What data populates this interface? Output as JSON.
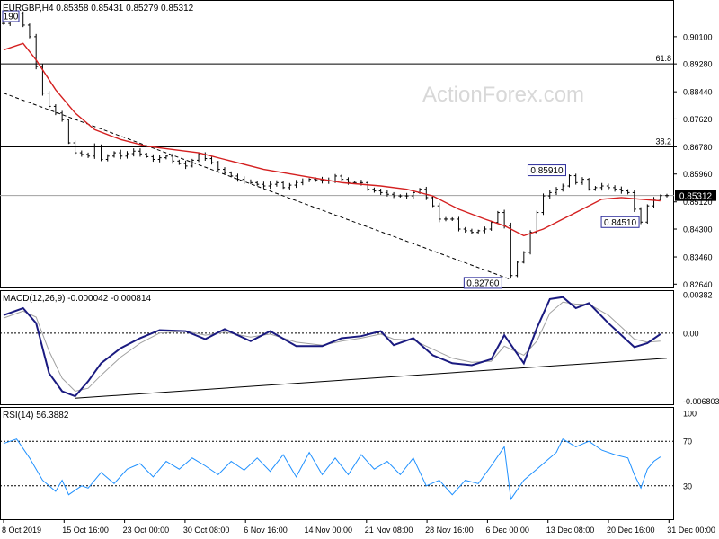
{
  "header": {
    "symbol_line": "EURGBP,H4  0.85358 0.85431 0.85279 0.85312"
  },
  "watermark": "ActionForex.com",
  "chart_data": [
    {
      "type": "candlestick",
      "title": "EURGBP,H4",
      "ohlc_header": {
        "open": 0.85358,
        "high": 0.85431,
        "low": 0.85279,
        "close": 0.85312
      },
      "ylim": [
        0.8254,
        0.9118
      ],
      "y_ticks": [
        "0.90100",
        "0.89280",
        "0.88440",
        "0.87620",
        "0.86780",
        "0.85960",
        "0.85120",
        "0.84300",
        "0.83460",
        "0.82640"
      ],
      "x_ticks": [
        "8 Oct 2019",
        "15 Oct 16:00",
        "23 Oct 00:00",
        "30 Oct 08:00",
        "6 Nov 16:00",
        "14 Nov 00:00",
        "21 Nov 08:00",
        "28 Nov 16:00",
        "6 Dec 00:00",
        "13 Dec 08:00",
        "20 Dec 16:00",
        "31 Dec 00:00"
      ],
      "price_path": [
        [
          0,
          0.905
        ],
        [
          2,
          0.908
        ],
        [
          4,
          0.901
        ],
        [
          5,
          0.892
        ],
        [
          6,
          0.884
        ],
        [
          7,
          0.88
        ],
        [
          9,
          0.876
        ],
        [
          10,
          0.869
        ],
        [
          11,
          0.866
        ],
        [
          13,
          0.865
        ],
        [
          14,
          0.868
        ],
        [
          15,
          0.864
        ],
        [
          17,
          0.866
        ],
        [
          18,
          0.865
        ],
        [
          20,
          0.8665
        ],
        [
          23,
          0.864
        ],
        [
          25,
          0.865
        ],
        [
          26,
          0.8635
        ],
        [
          28,
          0.862
        ],
        [
          30,
          0.8655
        ],
        [
          32,
          0.863
        ],
        [
          33,
          0.861
        ],
        [
          34,
          0.86
        ],
        [
          36,
          0.858
        ],
        [
          38,
          0.857
        ],
        [
          40,
          0.856
        ],
        [
          42,
          0.857
        ],
        [
          43,
          0.8555
        ],
        [
          45,
          0.857
        ],
        [
          47,
          0.858
        ],
        [
          50,
          0.8575
        ],
        [
          51,
          0.859
        ],
        [
          53,
          0.857
        ],
        [
          55,
          0.857
        ],
        [
          56,
          0.855
        ],
        [
          58,
          0.854
        ],
        [
          60,
          0.853
        ],
        [
          62,
          0.853
        ],
        [
          64,
          0.855
        ],
        [
          66,
          0.85
        ],
        [
          67,
          0.846
        ],
        [
          69,
          0.846
        ],
        [
          70,
          0.843
        ],
        [
          72,
          0.842
        ],
        [
          74,
          0.843
        ],
        [
          75,
          0.845
        ],
        [
          76,
          0.848
        ],
        [
          77,
          0.844
        ],
        [
          78,
          0.829
        ],
        [
          79,
          0.833
        ],
        [
          80,
          0.836
        ],
        [
          81,
          0.842
        ],
        [
          82,
          0.848
        ],
        [
          83,
          0.853
        ],
        [
          85,
          0.855
        ],
        [
          86,
          0.856
        ],
        [
          87,
          0.8591
        ],
        [
          88,
          0.857
        ],
        [
          89,
          0.858
        ],
        [
          90,
          0.855
        ],
        [
          92,
          0.856
        ],
        [
          94,
          0.855
        ],
        [
          96,
          0.854
        ],
        [
          97,
          0.849
        ],
        [
          98,
          0.8451
        ],
        [
          99,
          0.85
        ],
        [
          100,
          0.852
        ],
        [
          101,
          0.8531
        ]
      ],
      "moving_average": [
        [
          0,
          0.897
        ],
        [
          3,
          0.899
        ],
        [
          5,
          0.894
        ],
        [
          8,
          0.885
        ],
        [
          11,
          0.878
        ],
        [
          14,
          0.873
        ],
        [
          18,
          0.87
        ],
        [
          22,
          0.868
        ],
        [
          26,
          0.867
        ],
        [
          30,
          0.866
        ],
        [
          34,
          0.864
        ],
        [
          40,
          0.861
        ],
        [
          46,
          0.859
        ],
        [
          52,
          0.857
        ],
        [
          58,
          0.856
        ],
        [
          62,
          0.855
        ],
        [
          66,
          0.853
        ],
        [
          70,
          0.849
        ],
        [
          74,
          0.846
        ],
        [
          77,
          0.844
        ],
        [
          80,
          0.841
        ],
        [
          83,
          0.843
        ],
        [
          86,
          0.846
        ],
        [
          89,
          0.849
        ],
        [
          92,
          0.852
        ],
        [
          95,
          0.8525
        ],
        [
          98,
          0.852
        ],
        [
          101,
          0.8515
        ]
      ],
      "horizontal_levels": [
        {
          "label": "61.8",
          "value": 0.8928
        },
        {
          "label": "38.2",
          "value": 0.8678
        }
      ],
      "current_price": "0.85312",
      "current_price_value": 0.85312,
      "price_labels": [
        {
          "text": "0.90190",
          "value": 0.9019,
          "bar": 0
        },
        {
          "text": "0.85910",
          "value": 0.8591,
          "bar": 87
        },
        {
          "text": "0.84510",
          "value": 0.8451,
          "bar": 98
        },
        {
          "text": "0.82760",
          "value": 0.8276,
          "bar": 78
        }
      ],
      "trendline": [
        [
          0,
          0.884
        ],
        [
          78,
          0.8278
        ]
      ]
    },
    {
      "type": "line",
      "title": "MACD(12,26,9) -0.000042 -0.000814",
      "ylim": [
        -0.0071,
        0.0042
      ],
      "y_ticks": [
        "0.00382",
        "0.00",
        "-0.006803"
      ],
      "series": [
        {
          "name": "MACD",
          "values": [
            [
              0,
              0.0018
            ],
            [
              3,
              0.0025
            ],
            [
              5,
              0.001
            ],
            [
              7,
              -0.004
            ],
            [
              9,
              -0.0058
            ],
            [
              11,
              -0.0063
            ],
            [
              13,
              -0.0048
            ],
            [
              15,
              -0.003
            ],
            [
              18,
              -0.0015
            ],
            [
              21,
              -0.0005
            ],
            [
              24,
              0.0003
            ],
            [
              28,
              0.0002
            ],
            [
              31,
              -0.0006
            ],
            [
              34,
              0.0004
            ],
            [
              38,
              -0.0008
            ],
            [
              41,
              0.0002
            ],
            [
              45,
              -0.0013
            ],
            [
              49,
              -0.0013
            ],
            [
              52,
              -0.0005
            ],
            [
              55,
              -0.0003
            ],
            [
              58,
              0.0002
            ],
            [
              60,
              -0.0012
            ],
            [
              63,
              -0.0005
            ],
            [
              66,
              -0.0022
            ],
            [
              69,
              -0.003
            ],
            [
              72,
              -0.0032
            ],
            [
              75,
              -0.0026
            ],
            [
              77,
              -0.0002
            ],
            [
              80,
              -0.003
            ],
            [
              82,
              0.0005
            ],
            [
              84,
              0.0034
            ],
            [
              86,
              0.0036
            ],
            [
              88,
              0.0025
            ],
            [
              90,
              0.003
            ],
            [
              93,
              0.001
            ],
            [
              95,
              -0.0002
            ],
            [
              97,
              -0.0014
            ],
            [
              99,
              -0.001
            ],
            [
              101,
              -0.0001
            ]
          ]
        },
        {
          "name": "Signal",
          "values": [
            [
              0,
              0.0015
            ],
            [
              3,
              0.0022
            ],
            [
              5,
              0.0016
            ],
            [
              7,
              -0.0018
            ],
            [
              9,
              -0.0045
            ],
            [
              11,
              -0.0058
            ],
            [
              13,
              -0.0055
            ],
            [
              15,
              -0.0042
            ],
            [
              18,
              -0.0024
            ],
            [
              21,
              -0.001
            ],
            [
              24,
              0.0
            ],
            [
              28,
              0.0002
            ],
            [
              31,
              -0.0002
            ],
            [
              34,
              0.0001
            ],
            [
              38,
              -0.0004
            ],
            [
              41,
              -0.0001
            ],
            [
              45,
              -0.0009
            ],
            [
              49,
              -0.0012
            ],
            [
              52,
              -0.0008
            ],
            [
              55,
              -0.0005
            ],
            [
              58,
              -0.0001
            ],
            [
              60,
              -0.0006
            ],
            [
              63,
              -0.0007
            ],
            [
              66,
              -0.0016
            ],
            [
              69,
              -0.0025
            ],
            [
              72,
              -0.0029
            ],
            [
              75,
              -0.0028
            ],
            [
              77,
              -0.0013
            ],
            [
              80,
              -0.0022
            ],
            [
              82,
              -0.0008
            ],
            [
              84,
              0.002
            ],
            [
              86,
              0.0031
            ],
            [
              88,
              0.0029
            ],
            [
              90,
              0.0029
            ],
            [
              93,
              0.0018
            ],
            [
              95,
              0.0006
            ],
            [
              97,
              -0.0006
            ],
            [
              99,
              -0.0009
            ],
            [
              101,
              -0.0008
            ]
          ]
        }
      ],
      "trendline": [
        [
          11,
          -0.0065
        ],
        [
          102,
          -0.0025
        ]
      ]
    },
    {
      "type": "line",
      "title": "RSI(14) 56.3882",
      "ylim": [
        0,
        100
      ],
      "y_ticks": [
        "100",
        "70",
        "30",
        "0"
      ],
      "levels": [
        70,
        30
      ],
      "series": [
        {
          "name": "RSI(14)",
          "values": [
            [
              0,
              68
            ],
            [
              2,
              72
            ],
            [
              4,
              55
            ],
            [
              6,
              35
            ],
            [
              8,
              25
            ],
            [
              9,
              35
            ],
            [
              10,
              22
            ],
            [
              12,
              30
            ],
            [
              13,
              28
            ],
            [
              15,
              42
            ],
            [
              17,
              32
            ],
            [
              19,
              45
            ],
            [
              21,
              50
            ],
            [
              23,
              38
            ],
            [
              25,
              52
            ],
            [
              27,
              45
            ],
            [
              29,
              55
            ],
            [
              31,
              48
            ],
            [
              33,
              40
            ],
            [
              35,
              52
            ],
            [
              37,
              44
            ],
            [
              39,
              55
            ],
            [
              41,
              43
            ],
            [
              43,
              58
            ],
            [
              45,
              38
            ],
            [
              47,
              60
            ],
            [
              49,
              40
            ],
            [
              51,
              55
            ],
            [
              53,
              40
            ],
            [
              55,
              58
            ],
            [
              57,
              45
            ],
            [
              59,
              52
            ],
            [
              61,
              40
            ],
            [
              63,
              55
            ],
            [
              65,
              30
            ],
            [
              67,
              35
            ],
            [
              69,
              22
            ],
            [
              71,
              35
            ],
            [
              73,
              32
            ],
            [
              75,
              48
            ],
            [
              77,
              65
            ],
            [
              78,
              18
            ],
            [
              80,
              35
            ],
            [
              82,
              45
            ],
            [
              84,
              55
            ],
            [
              85,
              60
            ],
            [
              86,
              72
            ],
            [
              88,
              65
            ],
            [
              90,
              70
            ],
            [
              92,
              62
            ],
            [
              94,
              58
            ],
            [
              96,
              55
            ],
            [
              97,
              40
            ],
            [
              98,
              28
            ],
            [
              99,
              45
            ],
            [
              100,
              52
            ],
            [
              101,
              56
            ]
          ]
        }
      ]
    }
  ]
}
